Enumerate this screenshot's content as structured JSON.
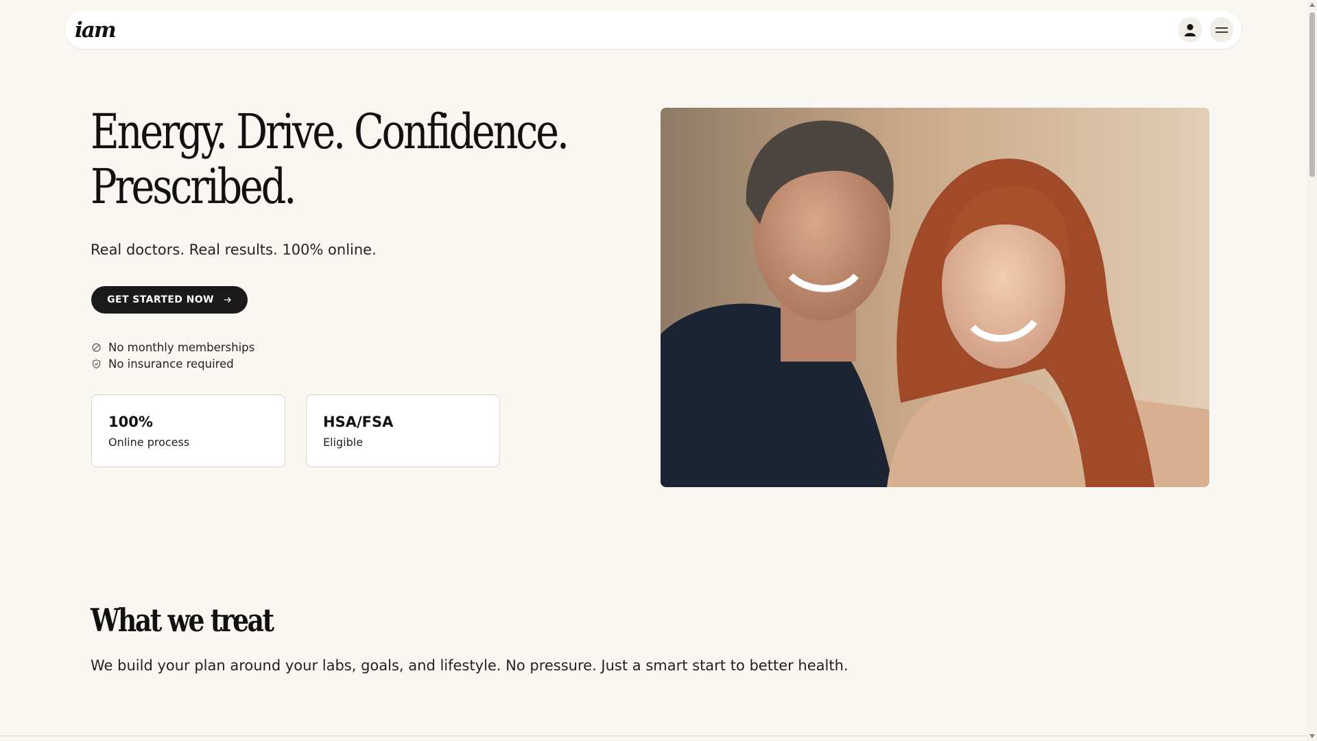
{
  "nav": {
    "logo": "iam",
    "account_icon": "user-icon",
    "menu_icon": "hamburger-menu-icon"
  },
  "hero": {
    "title_line1": "Energy. Drive. Confidence.",
    "title_line2": "Prescribed.",
    "subtitle": "Real doctors. Real results. 100% online.",
    "cta_label": "GET STARTED NOW",
    "cta_icon": "arrow-right-icon",
    "checks": [
      {
        "icon": "no-sign-icon",
        "label": "No monthly memberships"
      },
      {
        "icon": "shield-check-icon",
        "label": "No insurance required"
      }
    ],
    "stats": [
      {
        "value": "100%",
        "label": "Online process"
      },
      {
        "value": "HSA/FSA",
        "label": "Eligible"
      }
    ]
  },
  "treat": {
    "title": "What we treat",
    "subtitle": "We build your plan around your labs, goals, and lifestyle. No pressure. Just a smart start to better health."
  },
  "colors": {
    "background": "#faf7f2",
    "cta": "#1a1a1a",
    "card_border": "#d9d5ce"
  }
}
